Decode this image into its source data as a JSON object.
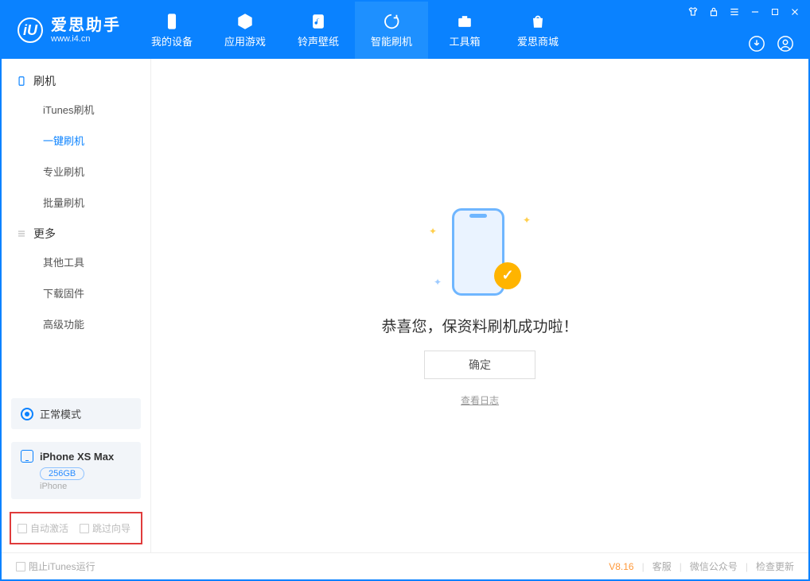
{
  "branding": {
    "title": "爱思助手",
    "subtitle": "www.i4.cn",
    "logo_letter": "iU"
  },
  "nav": {
    "tabs": [
      {
        "label": "我的设备"
      },
      {
        "label": "应用游戏"
      },
      {
        "label": "铃声壁纸"
      },
      {
        "label": "智能刷机"
      },
      {
        "label": "工具箱"
      },
      {
        "label": "爱思商城"
      }
    ],
    "active_index": 3
  },
  "sidebar": {
    "groups": [
      {
        "title": "刷机",
        "items": [
          "iTunes刷机",
          "一键刷机",
          "专业刷机",
          "批量刷机"
        ],
        "active_index": 1
      },
      {
        "title": "更多",
        "items": [
          "其他工具",
          "下载固件",
          "高级功能"
        ],
        "active_index": -1
      }
    ],
    "status": {
      "label": "正常模式"
    },
    "device": {
      "name": "iPhone XS Max",
      "capacity": "256GB",
      "type": "iPhone"
    },
    "bottom_options": {
      "auto_activate": "自动激活",
      "skip_wizard": "跳过向导"
    }
  },
  "main": {
    "message": "恭喜您，保资料刷机成功啦！",
    "ok_button": "确定",
    "view_log": "查看日志"
  },
  "footer": {
    "block_itunes": "阻止iTunes运行",
    "version": "V8.16",
    "links": [
      "客服",
      "微信公众号",
      "检查更新"
    ]
  }
}
